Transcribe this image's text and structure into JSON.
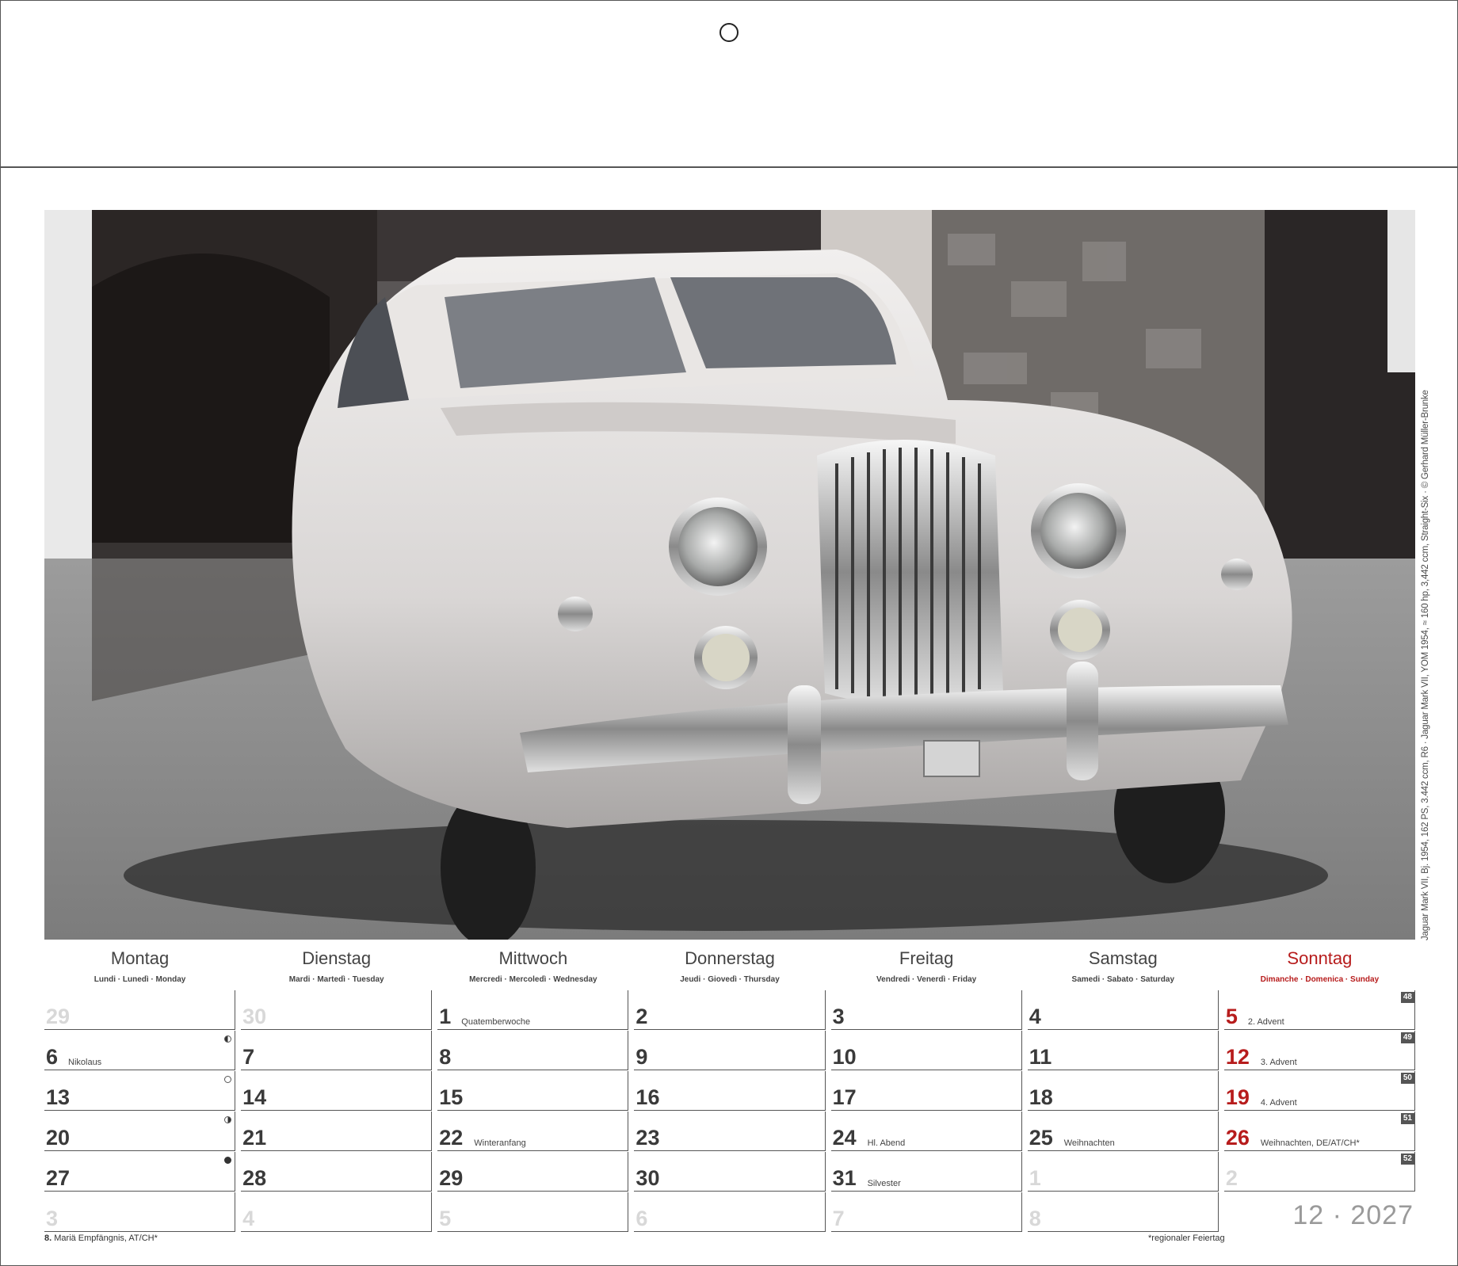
{
  "photo": {
    "subject": "White Jaguar Mark VII saloon parked in front of a stone building",
    "credit": "Jaguar Mark VII, Bj. 1954, 162 PS, 3.442 ccm, R6 · Jaguar Mark VII, YOM 1954, ≈ 160 hp, 3,442 ccm, Straight-Six · © Gerhard Müller-Brunke"
  },
  "weekdays": [
    {
      "name": "Montag",
      "sub": "Lundi · Lunedì · Monday"
    },
    {
      "name": "Dienstag",
      "sub": "Mardi · Martedì · Tuesday"
    },
    {
      "name": "Mittwoch",
      "sub": "Mercredi · Mercoledì · Wednesday"
    },
    {
      "name": "Donnerstag",
      "sub": "Jeudi · Giovedì · Thursday"
    },
    {
      "name": "Freitag",
      "sub": "Vendredi · Venerdì · Friday"
    },
    {
      "name": "Samstag",
      "sub": "Samedi · Sabato · Saturday"
    },
    {
      "name": "Sonntag",
      "sub": "Dimanche · Domenica · Sunday"
    }
  ],
  "weeks": [
    {
      "week_no": "48",
      "days": [
        {
          "n": "29",
          "faint": true
        },
        {
          "n": "30",
          "faint": true
        },
        {
          "n": "1",
          "note": "Quatemberwoche"
        },
        {
          "n": "2"
        },
        {
          "n": "3"
        },
        {
          "n": "4"
        },
        {
          "n": "5",
          "note": "2. Advent",
          "red": true
        }
      ]
    },
    {
      "week_no": "49",
      "days": [
        {
          "n": "6",
          "note": "Nikolaus",
          "moon": "last"
        },
        {
          "n": "7"
        },
        {
          "n": "8"
        },
        {
          "n": "9"
        },
        {
          "n": "10"
        },
        {
          "n": "11"
        },
        {
          "n": "12",
          "note": "3. Advent",
          "red": true
        }
      ]
    },
    {
      "week_no": "50",
      "days": [
        {
          "n": "13",
          "moon": "new"
        },
        {
          "n": "14"
        },
        {
          "n": "15"
        },
        {
          "n": "16"
        },
        {
          "n": "17"
        },
        {
          "n": "18"
        },
        {
          "n": "19",
          "note": "4. Advent",
          "red": true
        }
      ]
    },
    {
      "week_no": "51",
      "days": [
        {
          "n": "20",
          "moon": "first"
        },
        {
          "n": "21"
        },
        {
          "n": "22",
          "note": "Winteranfang"
        },
        {
          "n": "23"
        },
        {
          "n": "24",
          "note": "Hl. Abend"
        },
        {
          "n": "25",
          "note": "Weihnachten"
        },
        {
          "n": "26",
          "note": "Weihnachten, DE/AT/CH*",
          "red": true
        }
      ]
    },
    {
      "week_no": "52",
      "days": [
        {
          "n": "27",
          "moon": "full"
        },
        {
          "n": "28"
        },
        {
          "n": "29"
        },
        {
          "n": "30"
        },
        {
          "n": "31",
          "note": "Silvester"
        },
        {
          "n": "1",
          "faint": true
        },
        {
          "n": "2",
          "faint": true
        }
      ]
    },
    {
      "week_no": "",
      "days": [
        {
          "n": "3",
          "faint": true
        },
        {
          "n": "4",
          "faint": true
        },
        {
          "n": "5",
          "faint": true
        },
        {
          "n": "6",
          "faint": true
        },
        {
          "n": "7",
          "faint": true
        },
        {
          "n": "8",
          "faint": true
        },
        {
          "n": "",
          "empty": true
        }
      ]
    }
  ],
  "footer": {
    "left_bold": "8.",
    "left_text": " Mariä Empfängnis, AT/CH*",
    "right": "*regionaler Feiertag"
  },
  "month_year": "12 · 2027",
  "colors": {
    "sunday": "#b71c1c",
    "text": "#3a3a3a",
    "faint": "#d8d8d8"
  }
}
